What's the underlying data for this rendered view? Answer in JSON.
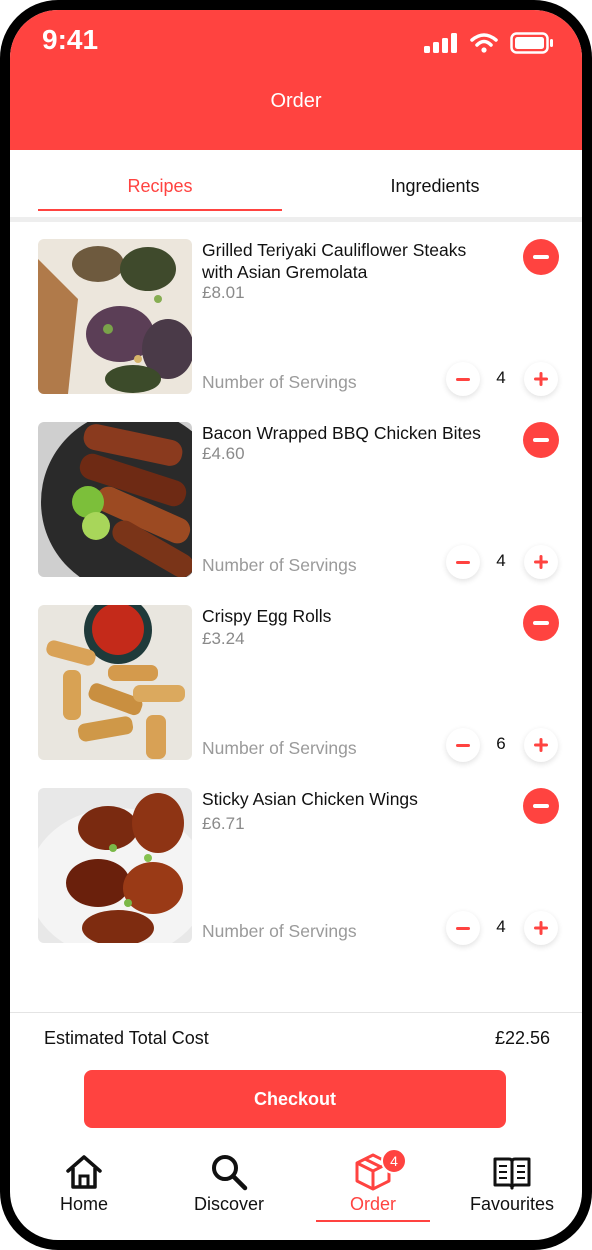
{
  "status_bar": {
    "time": "9:41"
  },
  "header": {
    "title": "Order"
  },
  "tabs": [
    {
      "label": "Recipes",
      "active": true
    },
    {
      "label": "Ingredients",
      "active": false
    }
  ],
  "servings_label": "Number of Servings",
  "items": [
    {
      "name": "Grilled Teriyaki Cauliflower Steaks with Asian Gremolata",
      "price": "£8.01",
      "servings": "4",
      "image": "cauliflower-steaks-photo"
    },
    {
      "name": "Bacon Wrapped BBQ Chicken Bites",
      "price": "£4.60",
      "servings": "4",
      "image": "bbq-chicken-bites-photo"
    },
    {
      "name": "Crispy Egg Rolls",
      "price": "£3.24",
      "servings": "6",
      "image": "egg-rolls-photo"
    },
    {
      "name": "Sticky Asian Chicken Wings",
      "price": "£6.71",
      "servings": "4",
      "image": "chicken-wings-photo"
    }
  ],
  "summary": {
    "total_label": "Estimated Total Cost",
    "total_value": "£22.56"
  },
  "checkout_label": "Checkout",
  "nav": [
    {
      "label": "Home",
      "icon": "home-icon",
      "active": false
    },
    {
      "label": "Discover",
      "icon": "search-icon",
      "active": false
    },
    {
      "label": "Order",
      "icon": "box-icon",
      "active": true,
      "badge": "4"
    },
    {
      "label": "Favourites",
      "icon": "book-icon",
      "active": false
    }
  ],
  "colors": {
    "accent": "#FF4340",
    "text": "#111111",
    "muted": "#8a8a8a"
  }
}
